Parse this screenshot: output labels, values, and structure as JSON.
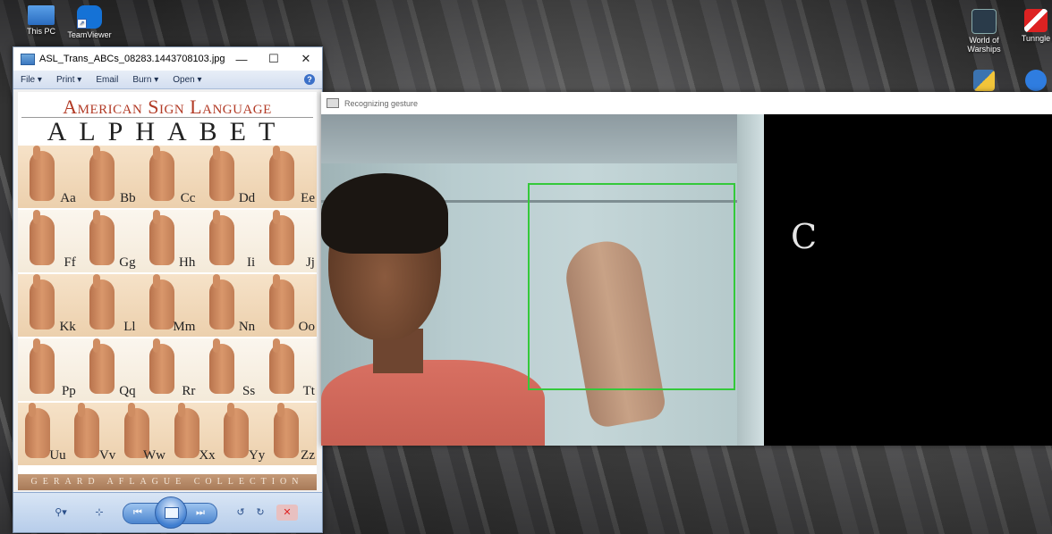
{
  "desktop": {
    "icons_left": [
      {
        "label": "This PC",
        "icon": "computer-icon"
      },
      {
        "label": "TeamViewer",
        "icon": "teamviewer-icon"
      }
    ],
    "icons_right": [
      {
        "label": "World of\nWarships",
        "icon": "world-of-warships-icon"
      },
      {
        "label": "Tunngle",
        "icon": "tunngle-icon"
      }
    ]
  },
  "viewer": {
    "title": "ASL_Trans_ABCs_08283.1443708103.jpg - Windo...",
    "menu": [
      "File",
      "Print",
      "Email",
      "Burn",
      "Open"
    ],
    "poster": {
      "title_line1": "American Sign Language",
      "title_line2": "ALPHABET",
      "rows": [
        [
          "Aa",
          "Bb",
          "Cc",
          "Dd",
          "Ee"
        ],
        [
          "Ff",
          "Gg",
          "Hh",
          "Ii",
          "Jj"
        ],
        [
          "Kk",
          "Ll",
          "Mm",
          "Nn",
          "Oo"
        ],
        [
          "Pp",
          "Qq",
          "Rr",
          "Ss",
          "Tt"
        ],
        [
          "Uu",
          "Vv",
          "Ww",
          "Xx",
          "Yy",
          "Zz"
        ]
      ],
      "footer": "GERARD AFLAGUE COLLECTION"
    }
  },
  "gesture_window": {
    "title": "Recognizing gesture",
    "predicted_letter": "C",
    "roi_color": "#34c93a"
  }
}
